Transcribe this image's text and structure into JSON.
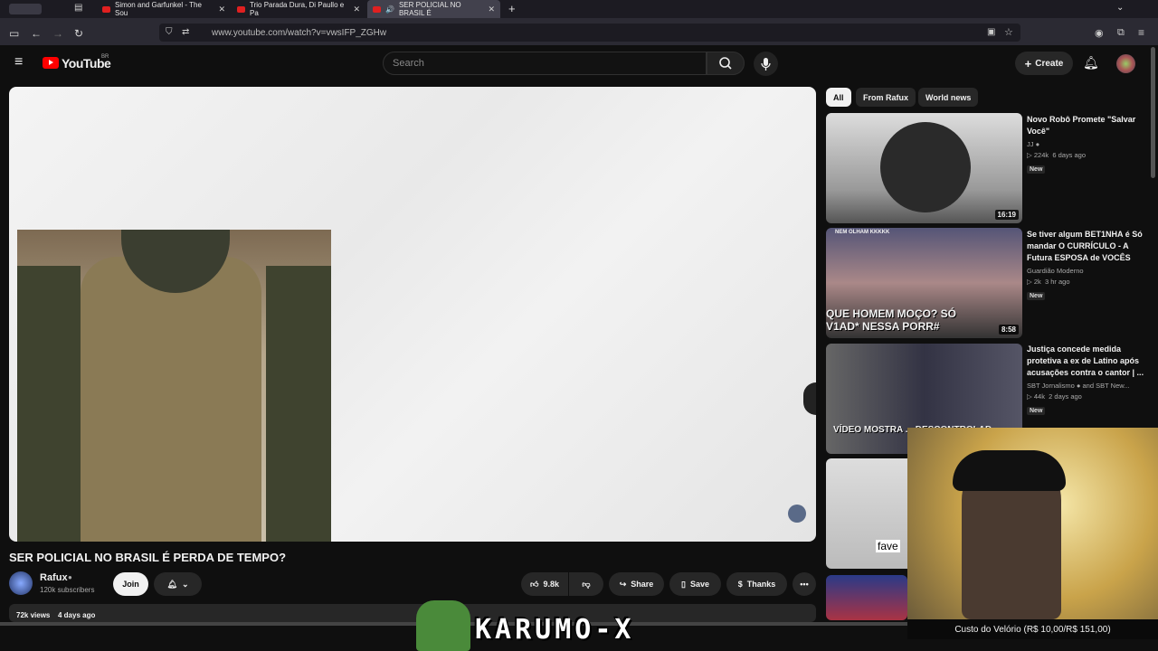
{
  "tabs": [
    {
      "title": "Simon and Garfunkel - The Sou"
    },
    {
      "title": "Trio Parada Dura, Di Paullo e Pa"
    },
    {
      "title": "SER POLICIAL NO BRASIL É"
    }
  ],
  "browser": {
    "url": "www.youtube.com/watch?v=vwsIFP_ZGHw"
  },
  "yt": {
    "logo": "YouTube",
    "region": "BR",
    "search_placeholder": "Search",
    "create_label": "Create"
  },
  "video": {
    "title": "SER POLICIAL NO BRASIL É PERDA DE TEMPO?",
    "channel": "Rafux",
    "subscribers": "120k subscribers",
    "join_label": "Join",
    "likes": "9.8k",
    "share_label": "Share",
    "save_label": "Save",
    "thanks_label": "Thanks",
    "views": "72k views",
    "age": "4 days ago"
  },
  "chips": [
    "All",
    "From Rafux",
    "World news"
  ],
  "recommendations": [
    {
      "title": "Novo Robô Promete \"Salvar Você\"",
      "channel": "JJ",
      "views": "224k",
      "age": "6 days ago",
      "badge": "New",
      "duration": "16:19"
    },
    {
      "title": "Se tiver algum BET1NHA é Só mandar O CURRÍCULO - A Futura ESPOSA de VOCÊS",
      "channel": "Guardião Moderno",
      "views": "2k",
      "age": "3 hr ago",
      "badge": "New",
      "duration": "8:58",
      "thumb_top": "NEM OLHAM KKKKK",
      "thumb_caption": "QUE HOMEM MOÇO? SÓ V1AD* NESSA PORR#"
    },
    {
      "title": "Justiça concede medida protetiva a ex de Latino após acusações contra o cantor | ...",
      "channel": "SBT Jornalismo",
      "channel_extra": "and SBT New...",
      "views": "44k",
      "age": "2 days ago",
      "badge": "New",
      "thumb_caption": "VÍDEO MOSTRA ... DESCONTROLAD"
    },
    {
      "thumb_caption": "fave"
    }
  ],
  "overlay": {
    "cost_text": "Custo do Velório (R$ 10,00/R$ 151,00)",
    "stream_name": "KARUMO-X"
  },
  "colors": {
    "brand": "#ff0000",
    "bg": "#0f0f0f",
    "accent": "#3ea6ff"
  }
}
